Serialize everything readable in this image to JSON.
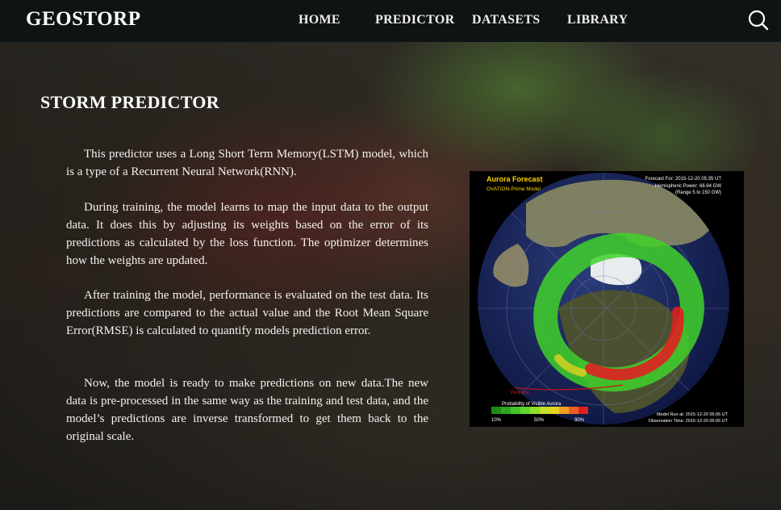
{
  "header": {
    "brand": "GEOSTORP",
    "nav": [
      "HOME",
      "PREDICTOR",
      "DATASETS",
      "LIBRARY"
    ]
  },
  "main": {
    "title": "STORM PREDICTOR",
    "paragraphs": [
      "This predictor uses a Long Short Term Memory(LSTM) model, which is a type of a Recurrent Neural Network(RNN).",
      "During training, the model learns to map the input data  to the output data. It does this by adjusting its weights based on the error of its predictions as calculated by the loss function. The optimizer determines how the weights are updated.",
      "After training the model, performance is evaluated on the test data. Its predictions are compared to the actual value and the Root Mean Square Error(RMSE) is calculated to quantify models prediction error.",
      "Now, the model is ready to make predictions on new data.The new data is pre-processed in the same way as the training and test data, and the model’s predictions are inverse transformed to get them back to the original scale."
    ]
  },
  "forecast_image": {
    "title": "Aurora Forecast",
    "model": "OVATION-Prime Model",
    "forecast_for": "Forecast For: 2015-12-20 05:35 UT",
    "hemispheric_power": "Hemispheric Power: 66.64 GW",
    "range": "(Range 5 to 150 GW)",
    "view_line": "View line",
    "probability_label": "Probability of Visible Aurora",
    "scale_ticks": [
      "10%",
      "50%",
      "90%"
    ],
    "model_run": "Model Run at: 2015-12-20 05:05 UT",
    "observation_time": "Observation Time: 2015-12-20 05:05 UT",
    "colors": {
      "title": "#ffd400",
      "text": "#ffffff",
      "aurora_green": "#3fd12a",
      "aurora_red": "#e02020",
      "view_line": "#d01010"
    }
  }
}
